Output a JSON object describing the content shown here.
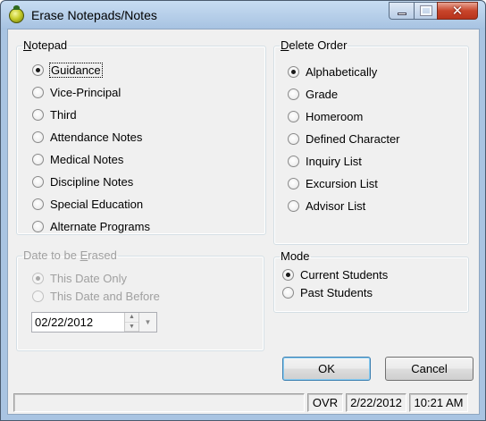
{
  "window": {
    "title": "Erase Notepads/Notes"
  },
  "notepad": {
    "legend": "Notepad",
    "options": [
      "Guidance",
      "Vice-Principal",
      "Third",
      "Attendance Notes",
      "Medical Notes",
      "Discipline Notes",
      "Special Education",
      "Alternate Programs"
    ],
    "selected": "Guidance"
  },
  "delete_order": {
    "legend": "Delete Order",
    "options": [
      "Alphabetically",
      "Grade",
      "Homeroom",
      "Defined Character",
      "Inquiry List",
      "Excursion List",
      "Advisor List"
    ],
    "selected": "Alphabetically"
  },
  "date_group": {
    "legend": "Date to be Erased",
    "options": [
      "This Date Only",
      "This Date and Before"
    ],
    "selected": "This Date Only",
    "date_value": "02/22/2012"
  },
  "mode": {
    "legend": "Mode",
    "options": [
      "Current Students",
      "Past Students"
    ],
    "selected": "Current Students"
  },
  "buttons": {
    "ok": "OK",
    "cancel": "Cancel"
  },
  "status": {
    "left": "",
    "ovr": "OVR",
    "date": "2/22/2012",
    "time": "10:21 AM"
  },
  "icons": {
    "app": "app-logo-icon",
    "minimize": "minimize-icon",
    "maximize": "maximize-icon",
    "close": "close-icon",
    "spin_up": "spin-up-icon",
    "spin_down": "spin-down-icon",
    "dropdown": "chevron-down-icon"
  }
}
